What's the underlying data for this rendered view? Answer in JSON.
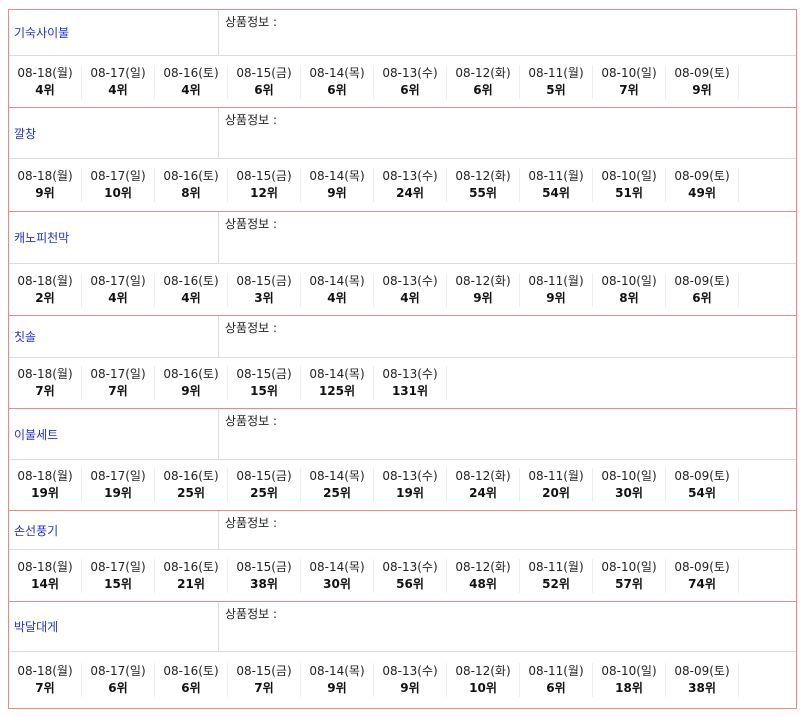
{
  "info_label": "상품정보 :",
  "blocks": [
    {
      "keyword": "기숙사이불",
      "ranks": [
        {
          "date": "08-18(월)",
          "rank": "4위"
        },
        {
          "date": "08-17(일)",
          "rank": "4위"
        },
        {
          "date": "08-16(토)",
          "rank": "4위"
        },
        {
          "date": "08-15(금)",
          "rank": "6위"
        },
        {
          "date": "08-14(목)",
          "rank": "6위"
        },
        {
          "date": "08-13(수)",
          "rank": "6위"
        },
        {
          "date": "08-12(화)",
          "rank": "6위"
        },
        {
          "date": "08-11(월)",
          "rank": "5위"
        },
        {
          "date": "08-10(일)",
          "rank": "7위"
        },
        {
          "date": "08-09(토)",
          "rank": "9위"
        }
      ]
    },
    {
      "keyword": "깔창",
      "ranks": [
        {
          "date": "08-18(월)",
          "rank": "9위"
        },
        {
          "date": "08-17(일)",
          "rank": "10위"
        },
        {
          "date": "08-16(토)",
          "rank": "8위"
        },
        {
          "date": "08-15(금)",
          "rank": "12위"
        },
        {
          "date": "08-14(목)",
          "rank": "9위"
        },
        {
          "date": "08-13(수)",
          "rank": "24위"
        },
        {
          "date": "08-12(화)",
          "rank": "55위"
        },
        {
          "date": "08-11(월)",
          "rank": "54위"
        },
        {
          "date": "08-10(일)",
          "rank": "51위"
        },
        {
          "date": "08-09(토)",
          "rank": "49위"
        }
      ]
    },
    {
      "keyword": "캐노피천막",
      "ranks": [
        {
          "date": "08-18(월)",
          "rank": "2위"
        },
        {
          "date": "08-17(일)",
          "rank": "4위"
        },
        {
          "date": "08-16(토)",
          "rank": "4위"
        },
        {
          "date": "08-15(금)",
          "rank": "3위"
        },
        {
          "date": "08-14(목)",
          "rank": "4위"
        },
        {
          "date": "08-13(수)",
          "rank": "4위"
        },
        {
          "date": "08-12(화)",
          "rank": "9위"
        },
        {
          "date": "08-11(월)",
          "rank": "9위"
        },
        {
          "date": "08-10(일)",
          "rank": "8위"
        },
        {
          "date": "08-09(토)",
          "rank": "6위"
        }
      ]
    },
    {
      "keyword": "칫솔",
      "ranks": [
        {
          "date": "08-18(월)",
          "rank": "7위"
        },
        {
          "date": "08-17(일)",
          "rank": "7위"
        },
        {
          "date": "08-16(토)",
          "rank": "9위"
        },
        {
          "date": "08-15(금)",
          "rank": "15위"
        },
        {
          "date": "08-14(목)",
          "rank": "125위"
        },
        {
          "date": "08-13(수)",
          "rank": "131위"
        }
      ]
    },
    {
      "keyword": "이불세트",
      "ranks": [
        {
          "date": "08-18(월)",
          "rank": "19위"
        },
        {
          "date": "08-17(일)",
          "rank": "19위"
        },
        {
          "date": "08-16(토)",
          "rank": "25위"
        },
        {
          "date": "08-15(금)",
          "rank": "25위"
        },
        {
          "date": "08-14(목)",
          "rank": "25위"
        },
        {
          "date": "08-13(수)",
          "rank": "19위"
        },
        {
          "date": "08-12(화)",
          "rank": "24위"
        },
        {
          "date": "08-11(월)",
          "rank": "20위"
        },
        {
          "date": "08-10(일)",
          "rank": "30위"
        },
        {
          "date": "08-09(토)",
          "rank": "54위"
        }
      ]
    },
    {
      "keyword": "손선풍기",
      "ranks": [
        {
          "date": "08-18(월)",
          "rank": "14위"
        },
        {
          "date": "08-17(일)",
          "rank": "15위"
        },
        {
          "date": "08-16(토)",
          "rank": "21위"
        },
        {
          "date": "08-15(금)",
          "rank": "38위"
        },
        {
          "date": "08-14(목)",
          "rank": "30위"
        },
        {
          "date": "08-13(수)",
          "rank": "56위"
        },
        {
          "date": "08-12(화)",
          "rank": "48위"
        },
        {
          "date": "08-11(월)",
          "rank": "52위"
        },
        {
          "date": "08-10(일)",
          "rank": "57위"
        },
        {
          "date": "08-09(토)",
          "rank": "74위"
        }
      ]
    },
    {
      "keyword": "박달대게",
      "ranks": [
        {
          "date": "08-18(월)",
          "rank": "7위"
        },
        {
          "date": "08-17(일)",
          "rank": "6위"
        },
        {
          "date": "08-16(토)",
          "rank": "6위"
        },
        {
          "date": "08-15(금)",
          "rank": "7위"
        },
        {
          "date": "08-14(목)",
          "rank": "9위"
        },
        {
          "date": "08-13(수)",
          "rank": "9위"
        },
        {
          "date": "08-12(화)",
          "rank": "10위"
        },
        {
          "date": "08-11(월)",
          "rank": "6위"
        },
        {
          "date": "08-10(일)",
          "rank": "18위"
        },
        {
          "date": "08-09(토)",
          "rank": "38위"
        }
      ]
    }
  ]
}
